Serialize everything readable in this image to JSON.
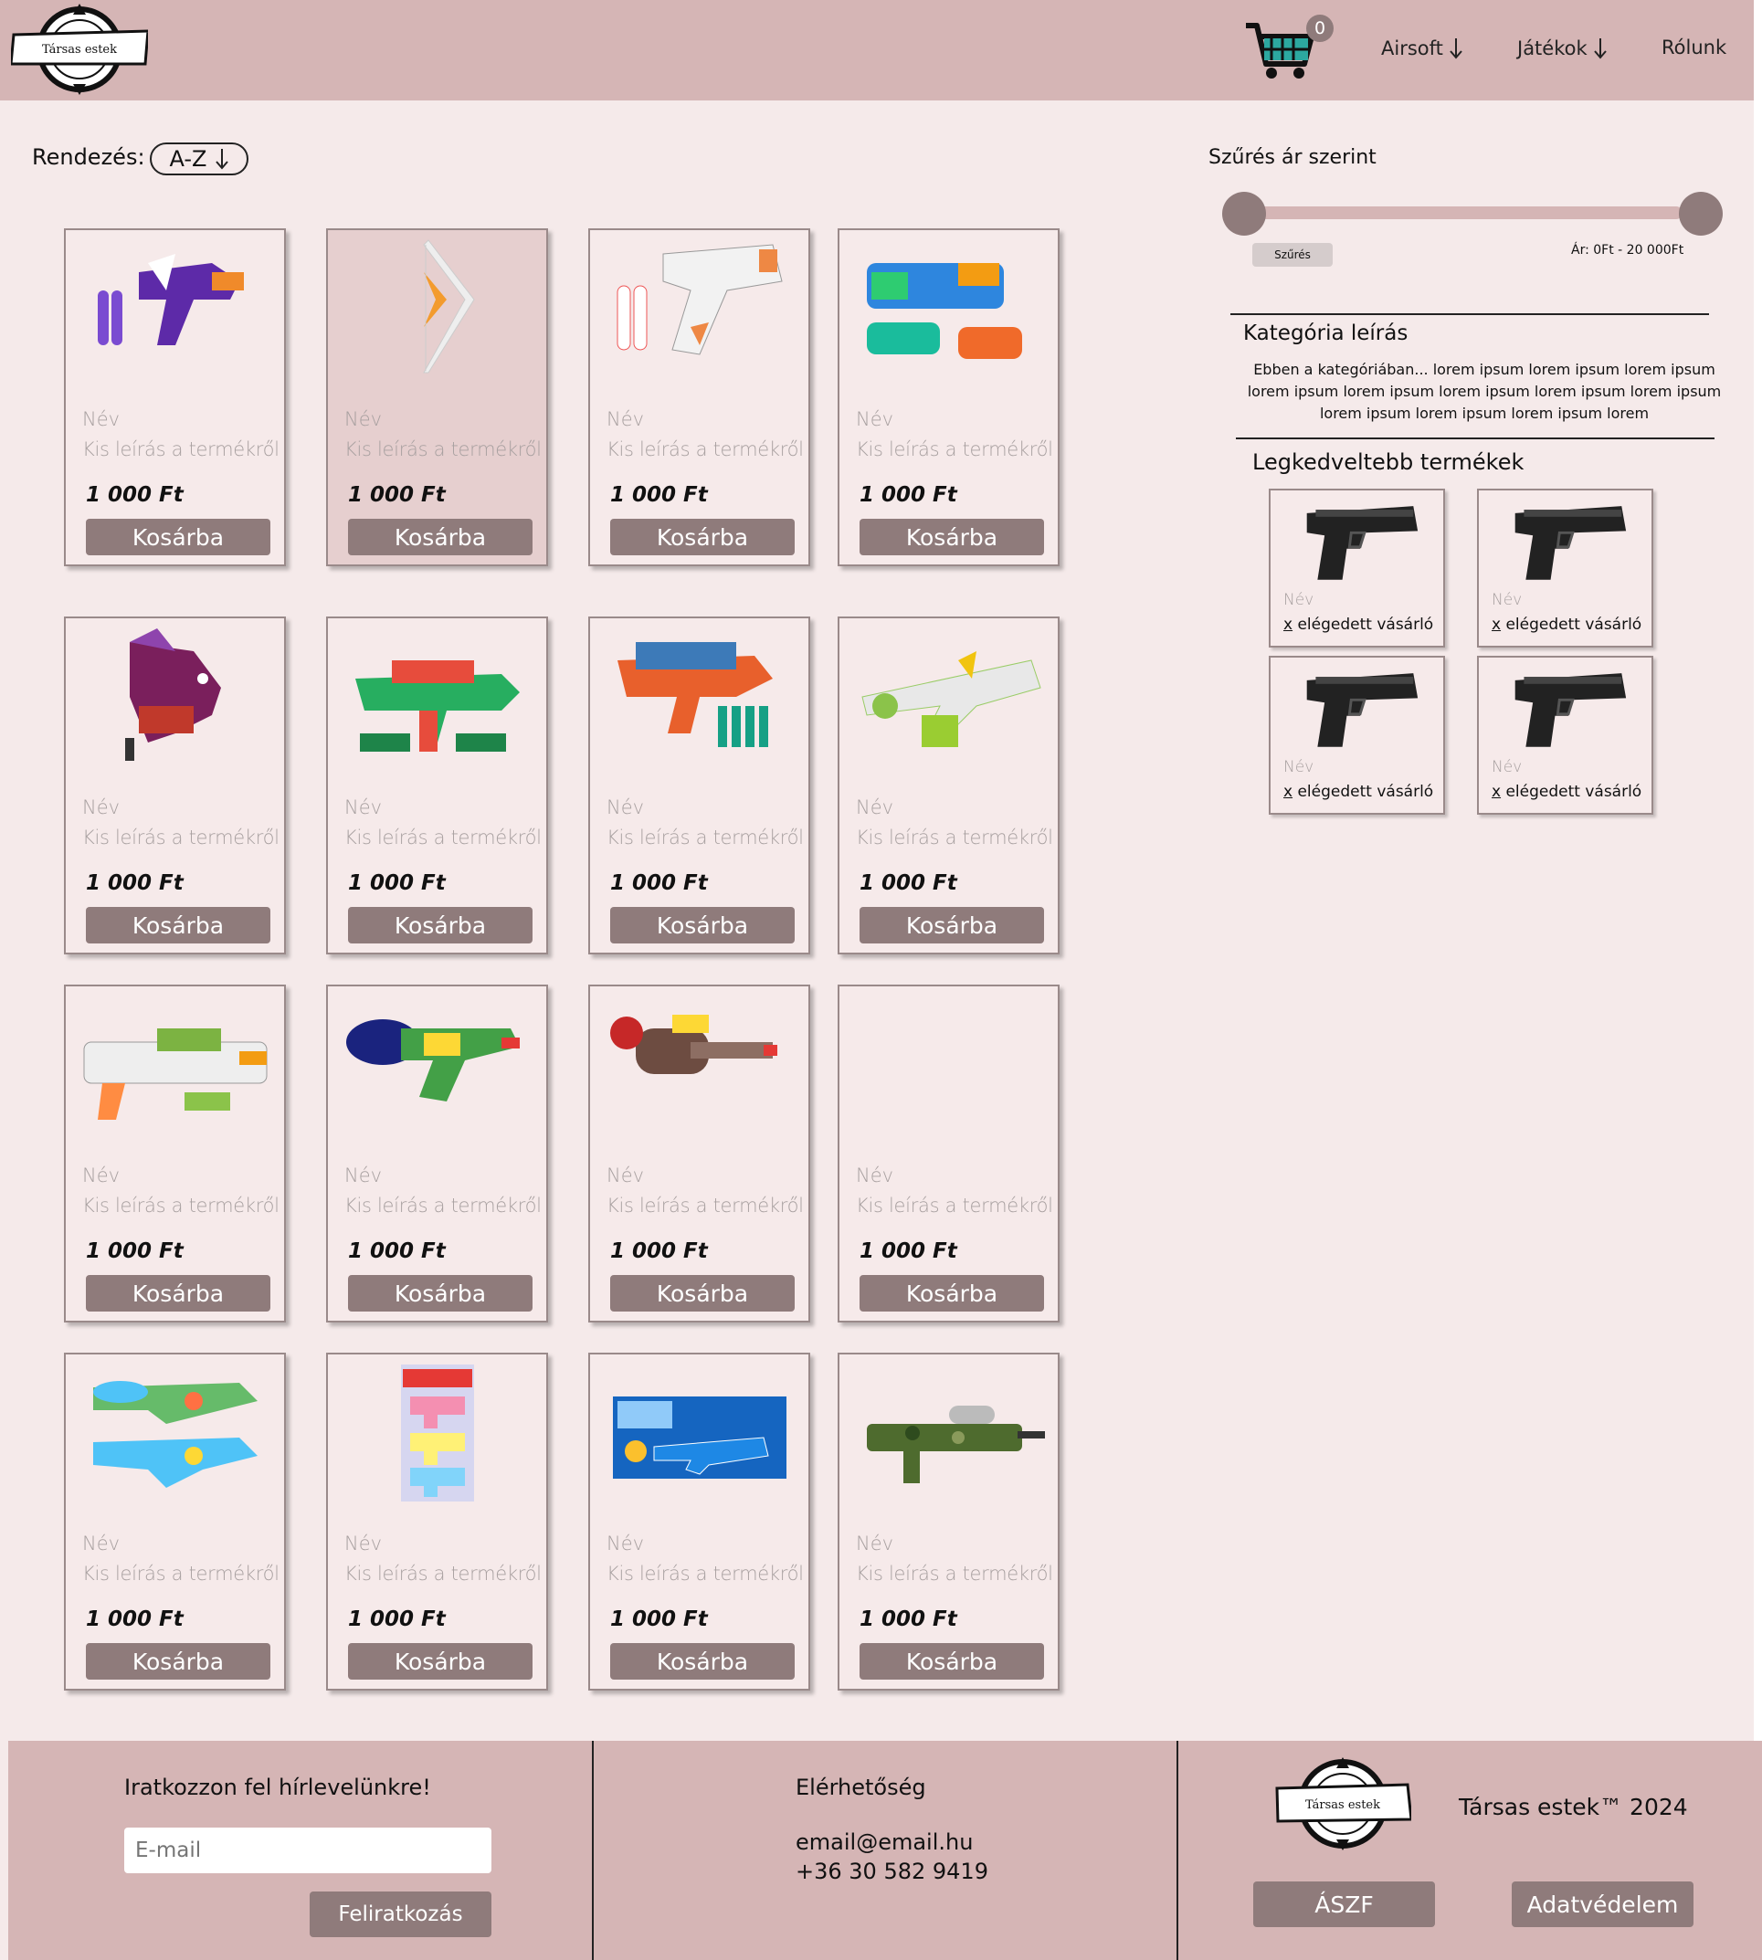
{
  "header": {
    "logo_text": "Társas estek",
    "cart_count": "0",
    "nav": [
      "Airsoft",
      "Játékok",
      "Rólunk"
    ]
  },
  "sort": {
    "label": "Rendezés:",
    "value": "A-Z"
  },
  "products": [
    {
      "name": "Név",
      "desc": "Kis leírás a termékről",
      "price": "1 000 Ft",
      "button": "Kosárba",
      "icon": "purple-nerf-blaster"
    },
    {
      "name": "Név",
      "desc": "Kis leírás a termékről",
      "price": "1 000 Ft",
      "button": "Kosárba",
      "icon": "nerf-bow"
    },
    {
      "name": "Név",
      "desc": "Kis leírás a termékről",
      "price": "1 000 Ft",
      "button": "Kosárba",
      "icon": "white-nerf-blaster"
    },
    {
      "name": "Név",
      "desc": "Kis leírás a termékről",
      "price": "1 000 Ft",
      "button": "Kosárba",
      "icon": "water-blaster-set"
    },
    {
      "name": "Név",
      "desc": "Kis leírás a termékről",
      "price": "1 000 Ft",
      "button": "Kosárba",
      "icon": "fortnite-llama-blaster"
    },
    {
      "name": "Név",
      "desc": "Kis leírás a termékről",
      "price": "1 000 Ft",
      "button": "Kosárba",
      "icon": "dino-blaster"
    },
    {
      "name": "Név",
      "desc": "Kis leírás a termékről",
      "price": "1 000 Ft",
      "button": "Kosárba",
      "icon": "dino-nerf-blaster"
    },
    {
      "name": "Név",
      "desc": "Kis leírás a termékről",
      "price": "1 000 Ft",
      "button": "Kosárba",
      "icon": "green-nerf-blaster"
    },
    {
      "name": "Név",
      "desc": "Kis leírás a termékről",
      "price": "1 000 Ft",
      "button": "Kosárba",
      "icon": "white-green-blaster"
    },
    {
      "name": "Név",
      "desc": "Kis leírás a termékről",
      "price": "1 000 Ft",
      "button": "Kosárba",
      "icon": "green-water-pistol"
    },
    {
      "name": "Név",
      "desc": "Kis leírás a termékről",
      "price": "1 000 Ft",
      "button": "Kosárba",
      "icon": "brown-water-blaster"
    },
    {
      "name": "Név",
      "desc": "Kis leírás a termékről",
      "price": "1 000 Ft",
      "button": "Kosárba",
      "icon": "empty-image"
    },
    {
      "name": "Név",
      "desc": "Kis leírás a termékről",
      "price": "1 000 Ft",
      "button": "Kosárba",
      "icon": "water-guns-pair"
    },
    {
      "name": "Név",
      "desc": "Kis leírás a termékről",
      "price": "1 000 Ft",
      "button": "Kosárba",
      "icon": "pastel-water-pistols"
    },
    {
      "name": "Név",
      "desc": "Kis leírás a termékről",
      "price": "1 000 Ft",
      "button": "Kosárba",
      "icon": "boxed-water-gun"
    },
    {
      "name": "Név",
      "desc": "Kis leírás a termékről",
      "price": "1 000 Ft",
      "button": "Kosárba",
      "icon": "camo-water-rifle"
    }
  ],
  "sidebar": {
    "filter_title": "Szűrés ár szerint",
    "slider_min_fraction": 0,
    "slider_max_fraction": 1,
    "filter_button": "Szűrés",
    "price_range": "Ár: 0Ft - 20 000Ft",
    "category_title": "Kategória leírás",
    "category_text": "Ebben a kategóriában... lorem ipsum lorem ipsum lorem ipsum lorem ipsum lorem ipsum lorem ipsum lorem ipsum lorem ipsum lorem ipsum lorem ipsum lorem ipsum lorem",
    "favorites_title": "Legkedveltebb termékek",
    "favorites": [
      {
        "name": "Név",
        "sat_x": "x",
        "sat_text": " elégedett vásárló"
      },
      {
        "name": "Név",
        "sat_x": "x",
        "sat_text": " elégedett vásárló"
      },
      {
        "name": "Név",
        "sat_x": "x",
        "sat_text": " elégedett vásárló"
      },
      {
        "name": "Név",
        "sat_x": "x",
        "sat_text": " elégedett vásárló"
      }
    ]
  },
  "footer": {
    "newsletter_title": "Iratkozzon fel hírlevelünkre!",
    "email_placeholder": "E-mail",
    "subscribe_button": "Feliratkozás",
    "contact_title": "Elérhetőség",
    "email": "email@email.hu",
    "phone": "+36 30 582 9419",
    "copyright": "Társas estek™ 2024",
    "terms_button": "ÁSZF",
    "privacy_button": "Adatvédelem"
  },
  "colors": {
    "header_bg": "#d5b5b5",
    "page_bg": "#f5eaea",
    "button": "#8f7b7b"
  }
}
